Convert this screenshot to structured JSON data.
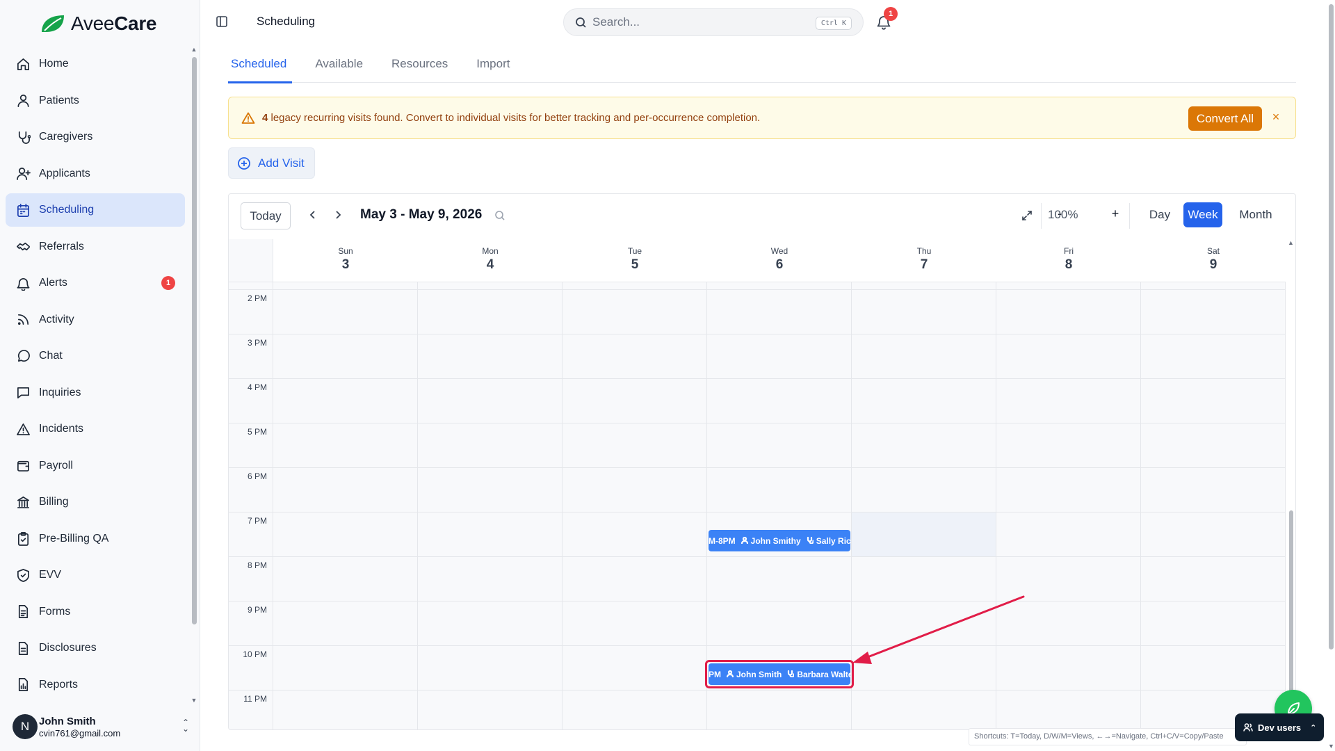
{
  "brand": {
    "name_light": "Avee",
    "name_bold": "Care",
    "accent": "#2563eb",
    "logo_color": "#16a34a"
  },
  "sidebar": {
    "items": [
      {
        "label": "Home",
        "icon": "home-icon"
      },
      {
        "label": "Patients",
        "icon": "user-icon"
      },
      {
        "label": "Caregivers",
        "icon": "stethoscope-icon"
      },
      {
        "label": "Applicants",
        "icon": "user-plus-icon"
      },
      {
        "label": "Scheduling",
        "icon": "calendar-icon",
        "active": true
      },
      {
        "label": "Referrals",
        "icon": "handshake-icon"
      },
      {
        "label": "Alerts",
        "icon": "bell-icon",
        "badge": "1"
      },
      {
        "label": "Activity",
        "icon": "rss-icon"
      },
      {
        "label": "Chat",
        "icon": "message-circle-icon"
      },
      {
        "label": "Inquiries",
        "icon": "message-square-icon"
      },
      {
        "label": "Incidents",
        "icon": "alert-triangle-icon"
      },
      {
        "label": "Payroll",
        "icon": "wallet-icon"
      },
      {
        "label": "Billing",
        "icon": "landmark-icon"
      },
      {
        "label": "Pre-Billing QA",
        "icon": "clipboard-check-icon"
      },
      {
        "label": "EVV",
        "icon": "shield-check-icon"
      },
      {
        "label": "Forms",
        "icon": "file-text-icon"
      },
      {
        "label": "Disclosures",
        "icon": "file-icon"
      },
      {
        "label": "Reports",
        "icon": "report-icon"
      }
    ],
    "user": {
      "initial": "N",
      "name": "John Smith",
      "email": "cvin761@gmail.com"
    }
  },
  "header": {
    "title": "Scheduling",
    "search_placeholder": "Search...",
    "search_shortcut": "Ctrl K",
    "notification_count": "1"
  },
  "tabs": [
    {
      "label": "Scheduled",
      "active": true
    },
    {
      "label": "Available"
    },
    {
      "label": "Resources"
    },
    {
      "label": "Import"
    }
  ],
  "banner": {
    "count": "4",
    "message": " legacy recurring visits found. Convert to individual visits for better tracking and per-occurrence completion.",
    "action": "Convert All",
    "close": "×"
  },
  "add_visit_label": "Add Visit",
  "calendar": {
    "today_label": "Today",
    "date_range": "May 3 - May 9, 2026",
    "zoom_minus": "-",
    "zoom": "100%",
    "zoom_plus": "+",
    "views": [
      "Day",
      "Week",
      "Month"
    ],
    "active_view": "Week",
    "days": [
      {
        "name": "Sun",
        "num": "3"
      },
      {
        "name": "Mon",
        "num": "4"
      },
      {
        "name": "Tue",
        "num": "5"
      },
      {
        "name": "Wed",
        "num": "6"
      },
      {
        "name": "Thu",
        "num": "7"
      },
      {
        "name": "Fri",
        "num": "8"
      },
      {
        "name": "Sat",
        "num": "9"
      }
    ],
    "hours": [
      "2 PM",
      "3 PM",
      "4 PM",
      "5 PM",
      "6 PM",
      "7 PM",
      "8 PM",
      "9 PM",
      "10 PM",
      "11 PM"
    ],
    "events": [
      {
        "time": "M-8PM",
        "patient": "John Smithy",
        "caregiver": "Sally Ric",
        "day": "Wed",
        "hour": "7 PM"
      },
      {
        "time": "PM",
        "patient": "John Smith",
        "caregiver": "Barbara Walte",
        "day": "Wed",
        "hour": "10 PM",
        "highlighted": true
      }
    ]
  },
  "shortcuts": "Shortcuts: T=Today, D/W/M=Views, ←→=Navigate, Ctrl+C/V=Copy/Paste",
  "dev_users_label": "Dev users"
}
